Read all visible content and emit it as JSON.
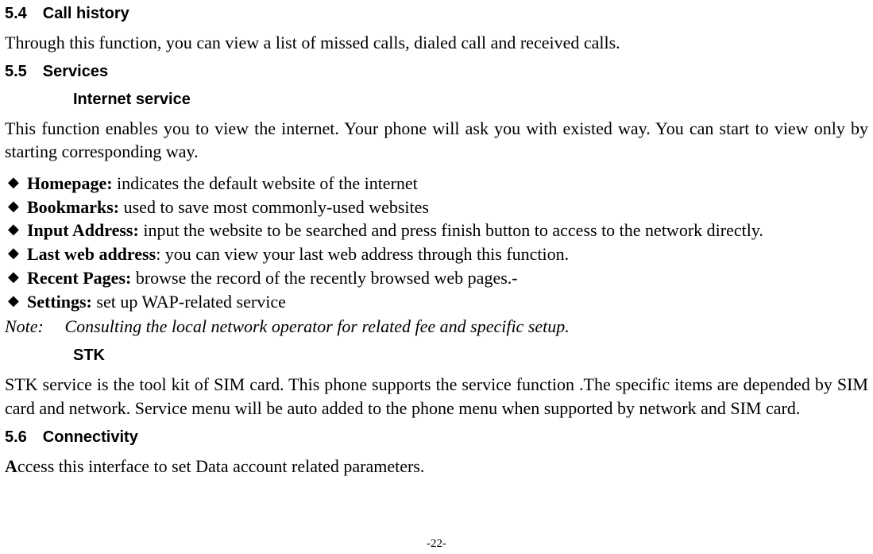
{
  "sections": {
    "s54": {
      "num_title": "5.4 Call history",
      "body": "Through this function, you can view a list of missed calls, dialed call and received calls."
    },
    "s55": {
      "num_title": "5.5 Services"
    },
    "internet": {
      "title": "Internet service",
      "intro": "This function enables you to view the internet. Your phone will ask you with existed way. You can start to view only by starting corresponding way.",
      "items": [
        {
          "label": "Homepage:",
          "text": " indicates the default website of the internet"
        },
        {
          "label": "Bookmarks:",
          "text": " used to save most commonly-used websites"
        },
        {
          "label": "Input Address:",
          "text": " input the website to be searched and press finish button to access to the network directly."
        },
        {
          "label": "Last web address",
          "text": ": you can view your last web address through this function."
        },
        {
          "label": "Recent Pages:",
          "text": " browse the record of the recently browsed web pages.-"
        },
        {
          "label": "Settings:",
          "text": " set up WAP-related service"
        }
      ],
      "note_label": "Note:",
      "note_text": "Consulting the local network operator for related fee and specific setup."
    },
    "stk": {
      "title": "STK",
      "body": "STK service is the tool kit of SIM card. This phone supports the service function .The specific items are depended by SIM card and network. Service menu will be auto added to the phone menu when supported by network and SIM card."
    },
    "s56": {
      "num_title": "5.6 Connectivity",
      "body_prefix_bold": "A",
      "body_rest": "ccess this interface to set Data account related parameters."
    }
  },
  "footer": "-22-"
}
